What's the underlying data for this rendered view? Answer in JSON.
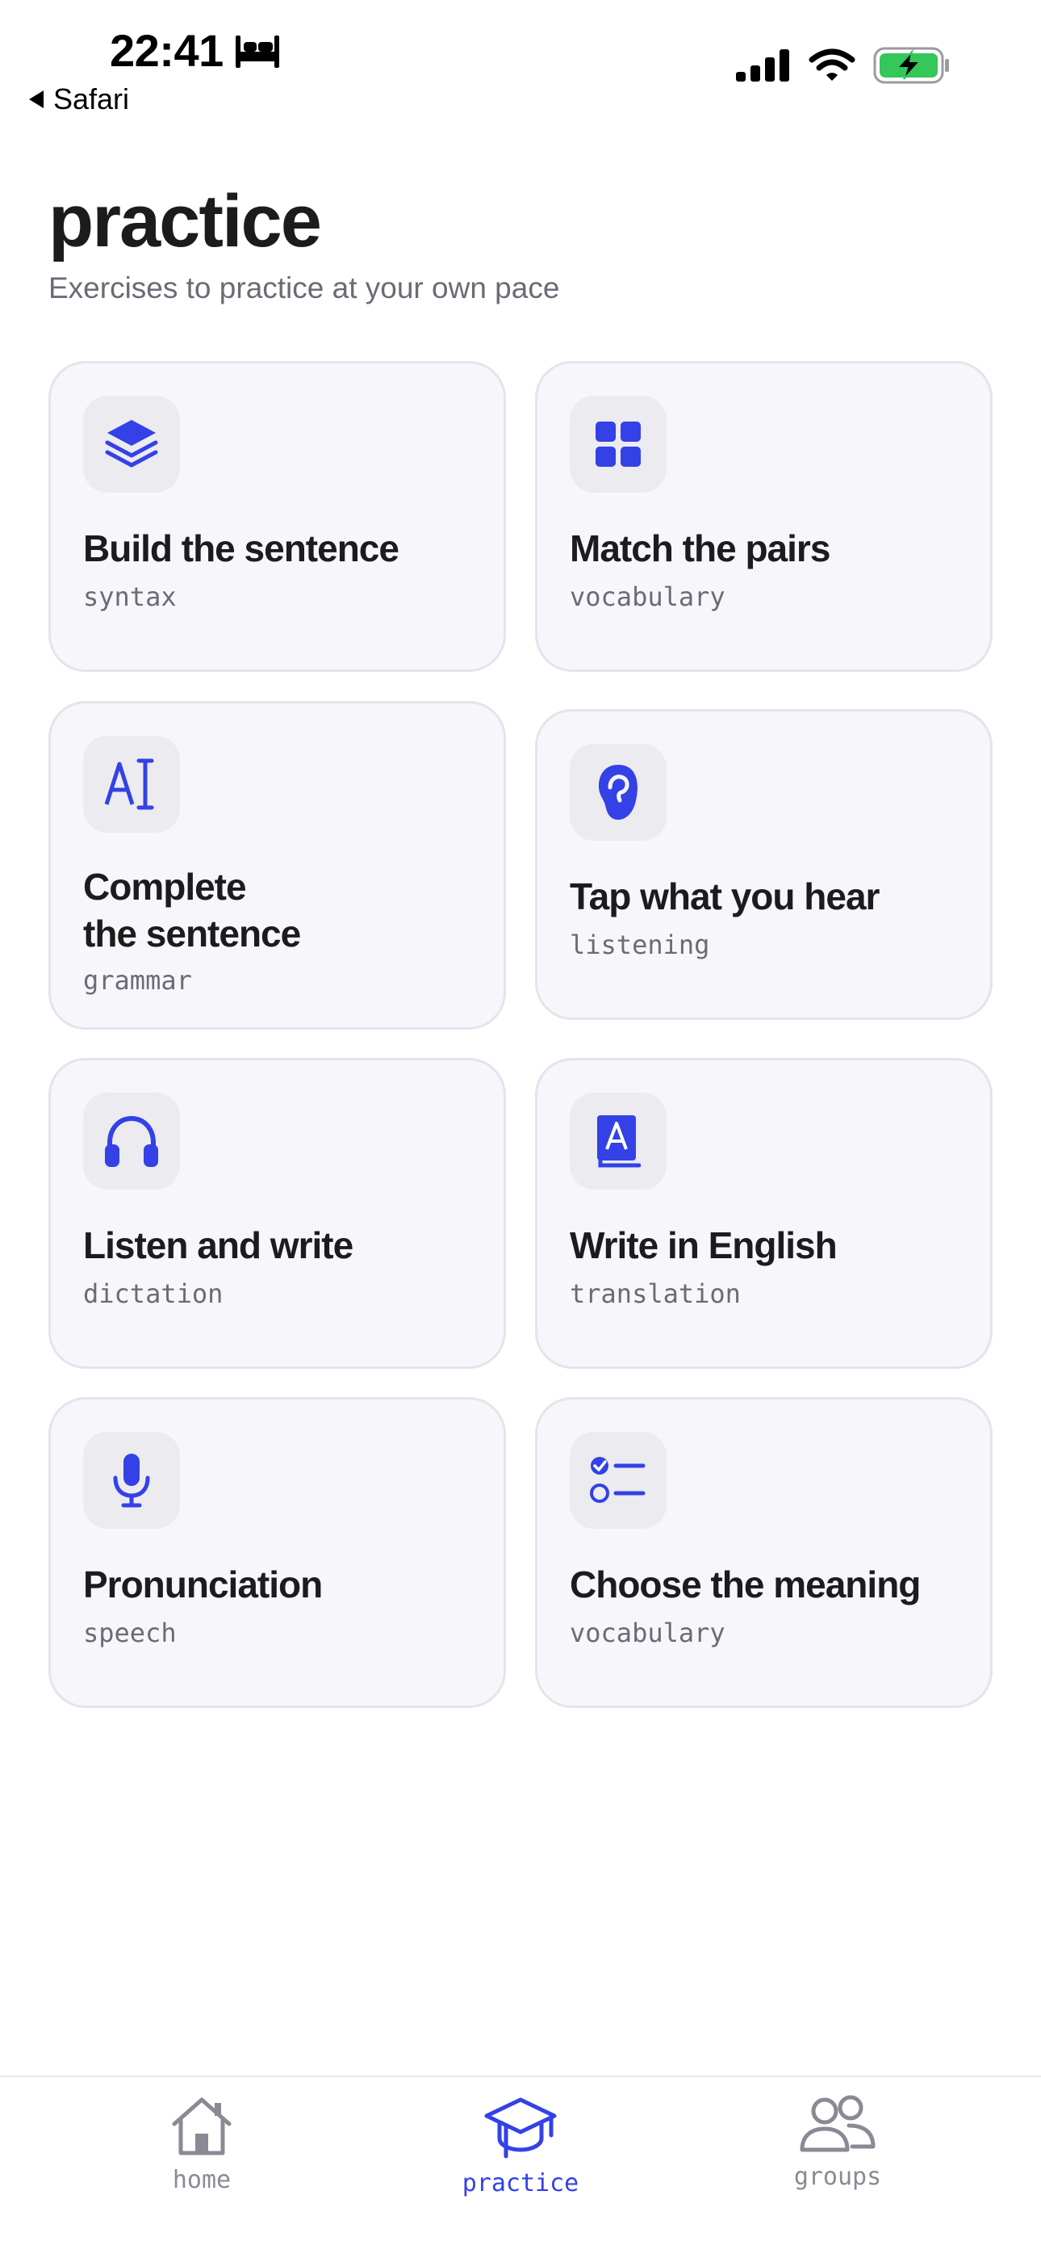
{
  "status_bar": {
    "time": "22:41",
    "back_label": "Safari"
  },
  "header": {
    "title": "practice",
    "subtitle": "Exercises to practice at your own pace"
  },
  "exercises": [
    {
      "title": "Build the sentence",
      "tag": "syntax",
      "icon": "layers-icon"
    },
    {
      "title": "Match the pairs",
      "tag": "vocabulary",
      "icon": "grid-icon"
    },
    {
      "title": "Complete\nthe sentence",
      "tag": "grammar",
      "icon": "text-cursor-icon"
    },
    {
      "title": "Tap what you hear",
      "tag": "listening",
      "icon": "ear-icon"
    },
    {
      "title": "Listen and write",
      "tag": "dictation",
      "icon": "headphones-icon"
    },
    {
      "title": "Write in English",
      "tag": "translation",
      "icon": "dictionary-icon"
    },
    {
      "title": "Pronunciation",
      "tag": "speech",
      "icon": "microphone-icon"
    },
    {
      "title": "Choose the meaning",
      "tag": "vocabulary",
      "icon": "checklist-icon"
    }
  ],
  "tab_bar": {
    "tabs": [
      {
        "label": "home",
        "icon": "home-icon",
        "active": false
      },
      {
        "label": "practice",
        "icon": "graduation-cap-icon",
        "active": true
      },
      {
        "label": "groups",
        "icon": "users-icon",
        "active": false
      }
    ]
  },
  "colors": {
    "accent": "#3341e6",
    "card_background": "#f6f6fb",
    "icon_tile": "#ebebf0",
    "battery_green": "#34c759"
  }
}
